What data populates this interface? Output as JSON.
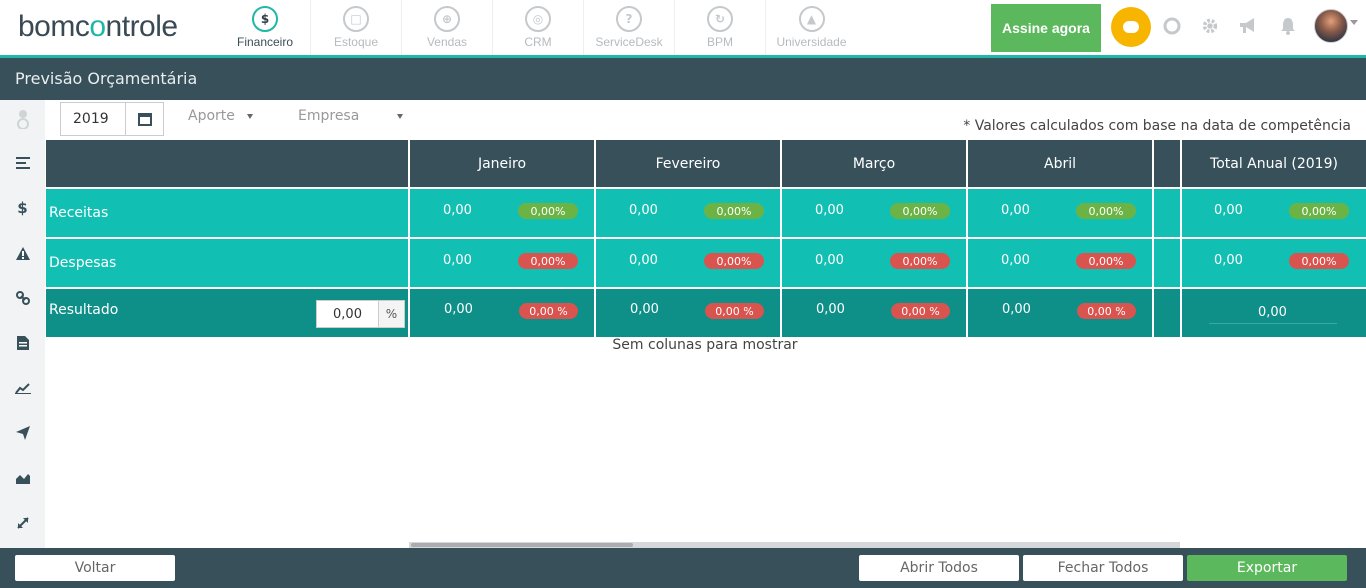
{
  "brand": {
    "name_part1": "bomc",
    "name_part2": "o",
    "name_part3": "ntrole"
  },
  "modules": [
    {
      "label": "Financeiro",
      "icon": "$",
      "active": true
    },
    {
      "label": "Estoque",
      "icon": "□"
    },
    {
      "label": "Vendas",
      "icon": "⊕"
    },
    {
      "label": "CRM",
      "icon": "◎"
    },
    {
      "label": "ServiceDesk",
      "icon": "?"
    },
    {
      "label": "BPM",
      "icon": "↻"
    },
    {
      "label": "Universidade",
      "icon": "▲"
    }
  ],
  "topbar": {
    "subscribe_label": "Assine agora"
  },
  "page": {
    "title": "Previsão Orçamentária"
  },
  "filters": {
    "year": "2019",
    "aporte_label": "Aporte",
    "empresa_label": "Empresa",
    "note": "* Valores calculados com base na data de competência"
  },
  "table": {
    "months": [
      "Janeiro",
      "Fevereiro",
      "Março",
      "Abril"
    ],
    "total_header": "Total Anual (2019)",
    "rows": {
      "receitas": {
        "label": "Receitas",
        "value": "0,00",
        "badge": "0,00%"
      },
      "despesas": {
        "label": "Despesas",
        "value": "0,00",
        "badge": "0,00%"
      },
      "resultado": {
        "label": "Resultado",
        "input_value": "0,00",
        "input_suffix": "%",
        "value": "0,00",
        "badge": "0,00 %",
        "total": "0,00"
      }
    },
    "empty_message": "Sem colunas para mostrar"
  },
  "footer": {
    "back_label": "Voltar",
    "open_all_label": "Abrir Todos",
    "close_all_label": "Fechar Todos",
    "export_label": "Exportar"
  },
  "colors": {
    "accent": "#1fb8a8",
    "header": "#37505a",
    "teal_row": "#12c0b3",
    "result_row": "#0e8f88",
    "positive": "#6cb346",
    "negative": "#d9534f"
  }
}
